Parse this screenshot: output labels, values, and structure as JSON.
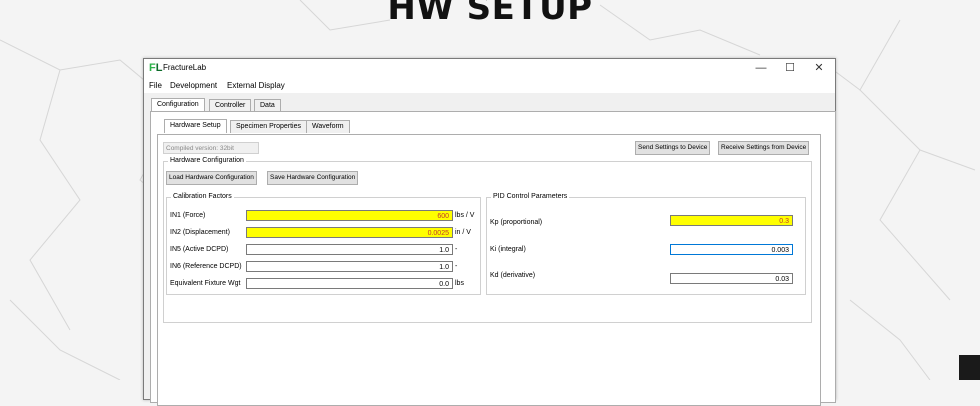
{
  "slide": {
    "title": "HW SETUP"
  },
  "window": {
    "app_title": "FractureLab",
    "logo_text": "FL",
    "controls": {
      "minimize": "—",
      "maximize": "☐",
      "close": "✕"
    }
  },
  "menu": {
    "items": [
      "File",
      "Development",
      "External Display"
    ]
  },
  "main_tabs": [
    "Configuration",
    "Controller",
    "Data"
  ],
  "sub_tabs": [
    "Hardware Setup",
    "Specimen Properties",
    "Waveform"
  ],
  "compiled_version": "Compiled version: 32bit",
  "buttons": {
    "send": "Send Settings to Device",
    "receive": "Receive Settings from Device",
    "load": "Load Hardware Configuration",
    "save": "Save Hardware Configuration"
  },
  "hardware_config": {
    "title": "Hardware Configuration",
    "calibration": {
      "title": "Calibration Factors",
      "rows": [
        {
          "label": "IN1 (Force)",
          "value": "600",
          "unit": "lbs / V",
          "highlight": true
        },
        {
          "label": "IN2 (Displacement)",
          "value": "0.0025",
          "unit": "in / V",
          "highlight": true
        },
        {
          "label": "IN5 (Active DCPD)",
          "value": "1.0",
          "unit": "-",
          "highlight": false
        },
        {
          "label": "IN6 (Reference DCPD)",
          "value": "1.0",
          "unit": "-",
          "highlight": false
        },
        {
          "label": "Equivalent Fixture Wgt",
          "value": "0.0",
          "unit": "lbs",
          "highlight": false
        }
      ]
    },
    "pid": {
      "title": "PID Control Parameters",
      "rows": [
        {
          "label": "Kp (proportional)",
          "value": "0.3",
          "highlight": true
        },
        {
          "label": "Ki (integral)",
          "value": "0.003",
          "highlight": false
        },
        {
          "label": "Kd (derivative)",
          "value": "0.03",
          "highlight": false
        }
      ]
    }
  },
  "colors": {
    "highlight": "#ffff00",
    "highlight_text": "#c0392b",
    "logo_green": "#2db24a"
  }
}
